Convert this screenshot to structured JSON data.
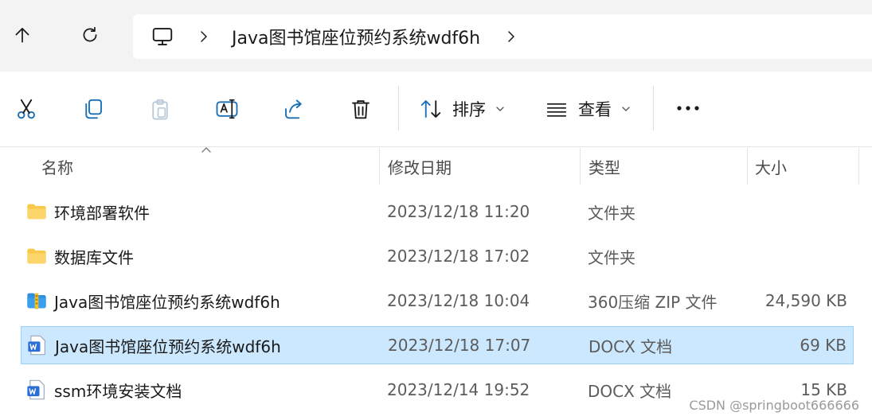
{
  "address": {
    "crumb": "Java图书馆座位预约系统wdf6h"
  },
  "toolbar": {
    "sort_label": "排序",
    "view_label": "查看"
  },
  "columns": {
    "name": "名称",
    "modified": "修改日期",
    "type": "类型",
    "size": "大小"
  },
  "files": [
    {
      "icon": "folder-icon",
      "name": "环境部署软件",
      "modified": "2023/12/18 11:20",
      "type": "文件夹",
      "size": ""
    },
    {
      "icon": "folder-icon",
      "name": "数据库文件",
      "modified": "2023/12/18 17:02",
      "type": "文件夹",
      "size": ""
    },
    {
      "icon": "zip-archive-icon",
      "name": "Java图书馆座位预约系统wdf6h",
      "modified": "2023/12/18 10:04",
      "type": "360压缩 ZIP 文件",
      "size": "24,590 KB"
    },
    {
      "icon": "word-document-icon",
      "name": "Java图书馆座位预约系统wdf6h",
      "modified": "2023/12/18 17:07",
      "type": "DOCX 文档",
      "size": "69 KB",
      "selected": true
    },
    {
      "icon": "word-document-icon",
      "name": "ssm环境安装文档",
      "modified": "2023/12/14 19:52",
      "type": "DOCX 文档",
      "size": "15 KB"
    }
  ],
  "watermark": "CSDN @springboot666666",
  "colors": {
    "selection_bg": "#cce8ff",
    "selection_border": "#99d1ff",
    "folder": "#f8c94a",
    "word": "#2b6fd6",
    "accent": "#1a6fb5"
  }
}
